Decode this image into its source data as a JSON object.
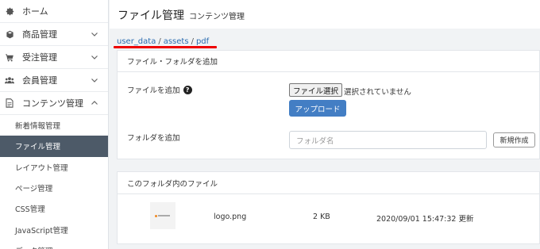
{
  "sidebar": {
    "items": [
      {
        "label": "ホーム",
        "icon": "gear-icon"
      },
      {
        "label": "商品管理",
        "icon": "cube-icon"
      },
      {
        "label": "受注管理",
        "icon": "cart-icon"
      },
      {
        "label": "会員管理",
        "icon": "users-icon"
      },
      {
        "label": "コンテンツ管理",
        "icon": "document-icon"
      }
    ],
    "sub_items": [
      {
        "label": "新着情報管理"
      },
      {
        "label": "ファイル管理"
      },
      {
        "label": "レイアウト管理"
      },
      {
        "label": "ページ管理"
      },
      {
        "label": "CSS管理"
      },
      {
        "label": "JavaScript管理"
      },
      {
        "label": "データ管理"
      }
    ],
    "active_sub_item": "ファイル管理"
  },
  "header": {
    "title": "ファイル管理",
    "subtitle": "コンテンツ管理"
  },
  "breadcrumb": {
    "parts": [
      "user_data",
      "assets",
      "pdf"
    ],
    "separator": "/"
  },
  "add_card": {
    "title": "ファイル・フォルダを追加",
    "file_label": "ファイルを追加",
    "file_button": "ファイル選択",
    "file_status": "選択されていません",
    "upload_button": "アップロード",
    "folder_label": "フォルダを追加",
    "folder_placeholder": "フォルダ名",
    "new_button": "新規作成"
  },
  "files_card": {
    "title": "このフォルダ内のファイル",
    "files": [
      {
        "name": "logo.png",
        "size": "2 KB",
        "updated": "2020/09/01 15:47:32 更新"
      }
    ]
  },
  "colors": {
    "accent": "#437ec4",
    "active_nav": "#4d5a68",
    "link": "#2b6cb0",
    "highlight": "#e00000"
  }
}
